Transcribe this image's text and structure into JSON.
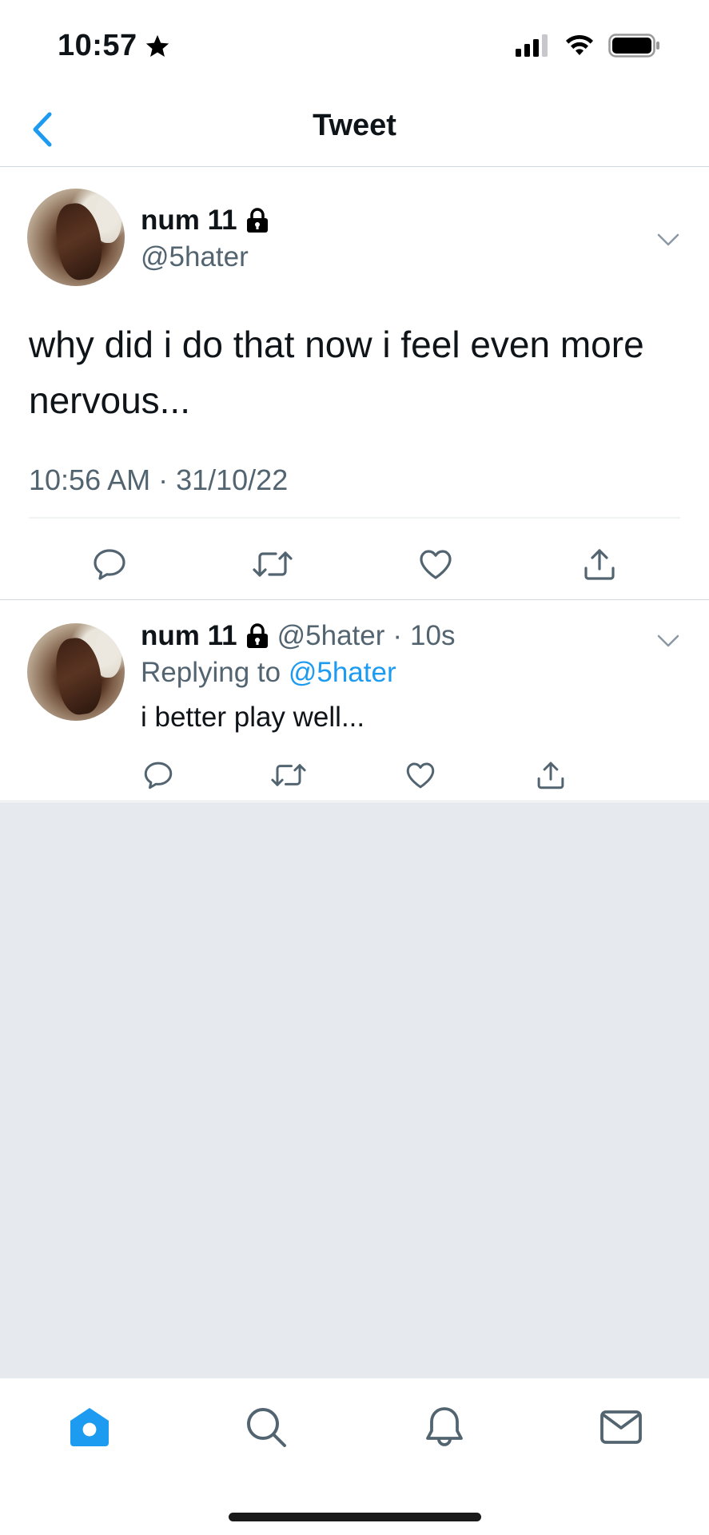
{
  "status_bar": {
    "time": "10:57",
    "signal_icon": "cellular-signal-icon",
    "wifi_icon": "wifi-icon",
    "battery_icon": "battery-icon"
  },
  "nav": {
    "title": "Tweet",
    "back_icon": "chevron-left-icon"
  },
  "main_tweet": {
    "author_name": "num 11",
    "author_handle": "@5hater",
    "text": "why did i do that now i feel even more nervous...",
    "timestamp": "10:56 AM · 31/10/22"
  },
  "reply_tweet": {
    "author_name": "num 11",
    "author_handle": "@5hater",
    "separator": "·",
    "time": "10s",
    "replying_to_prefix": "Replying to",
    "replying_to_handle": "@5hater",
    "text": "i better play well..."
  },
  "tab_bar": {
    "items": [
      "home-icon",
      "search-icon",
      "bell-icon",
      "mail-icon"
    ],
    "active": "home-icon"
  },
  "colors": {
    "accent": "#1d9bf0",
    "secondary_text": "#536471",
    "primary_text": "#0f1419",
    "empty_background": "#e6e9ee"
  }
}
